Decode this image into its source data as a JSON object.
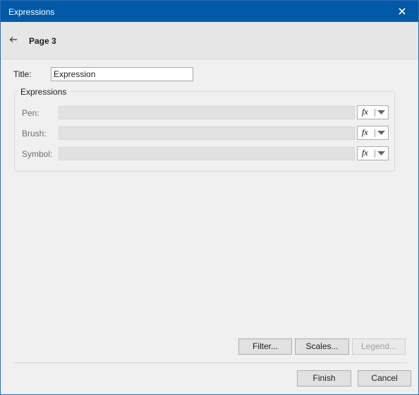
{
  "window": {
    "title": "Expressions"
  },
  "nav": {
    "page_title": "Page 3"
  },
  "form": {
    "title_label": "Title:",
    "title_value": "Expression",
    "group_caption": "Expressions",
    "rows": [
      {
        "label": "Pen:",
        "value": ""
      },
      {
        "label": "Brush:",
        "value": ""
      },
      {
        "label": "Symbol:",
        "value": ""
      }
    ],
    "fx_symbol": "fx"
  },
  "buttons": {
    "filter": "Filter...",
    "scales": "Scales...",
    "legend": "Legend...",
    "finish": "Finish",
    "cancel": "Cancel"
  },
  "icons": {
    "close": "close-icon",
    "back": "arrow-left-icon",
    "dropdown": "chevron-down-icon",
    "function": "function-icon"
  },
  "colors": {
    "titlebar": "#005aa8",
    "window_bg": "#f0f0f0",
    "nav_bg": "#e6e6e6",
    "field_disabled": "#e1e1e1"
  }
}
